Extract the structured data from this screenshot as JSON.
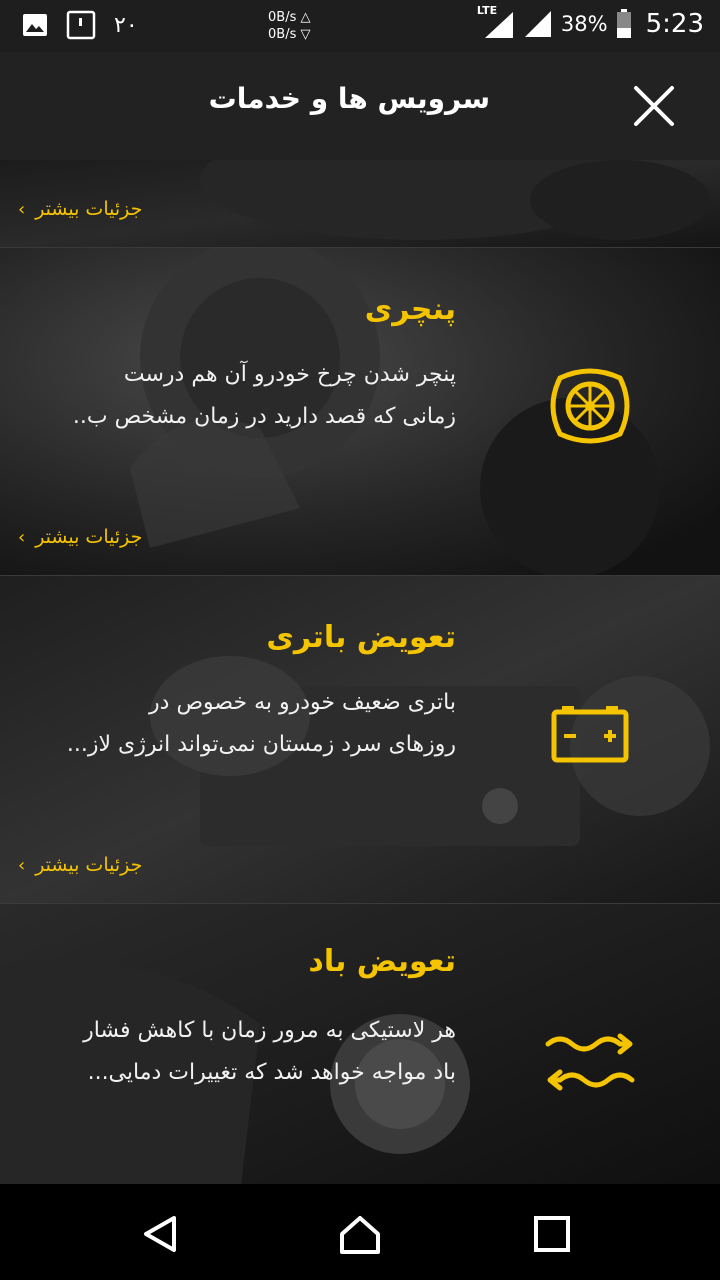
{
  "status_bar": {
    "notif_count": "۲۰",
    "net_up": "0B/s △",
    "net_down": "0B/s ▽",
    "network_type": "LTE",
    "battery": "38%",
    "time": "5:23"
  },
  "header": {
    "title": "سرویس ها و خدمات"
  },
  "more_label": "جزئیات بیشتر",
  "services": [
    {
      "title": "پنچری",
      "desc_line1": "پنچر شدن چرخ خودرو آن هم درست",
      "desc_line2": "زمانی که قصد دارید در زمان مشخص ب..",
      "icon": "tire-icon"
    },
    {
      "title": "تعویض باتری",
      "desc_line1": "باتری ضعیف خودرو به خصوص در",
      "desc_line2": "روزهای سرد زمستان نمی‌تواند انرژی لاز...",
      "icon": "battery-icon"
    },
    {
      "title": "تعویض باد",
      "desc_line1": "هر لاستیکی به مرور زمان با کاهش فشار",
      "desc_line2": "باد مواجه خواهد شد که تغییرات دمایی...",
      "icon": "air-exchange-icon"
    }
  ],
  "colors": {
    "accent": "#f5c400",
    "appbar": "#222222",
    "background": "#151515"
  }
}
